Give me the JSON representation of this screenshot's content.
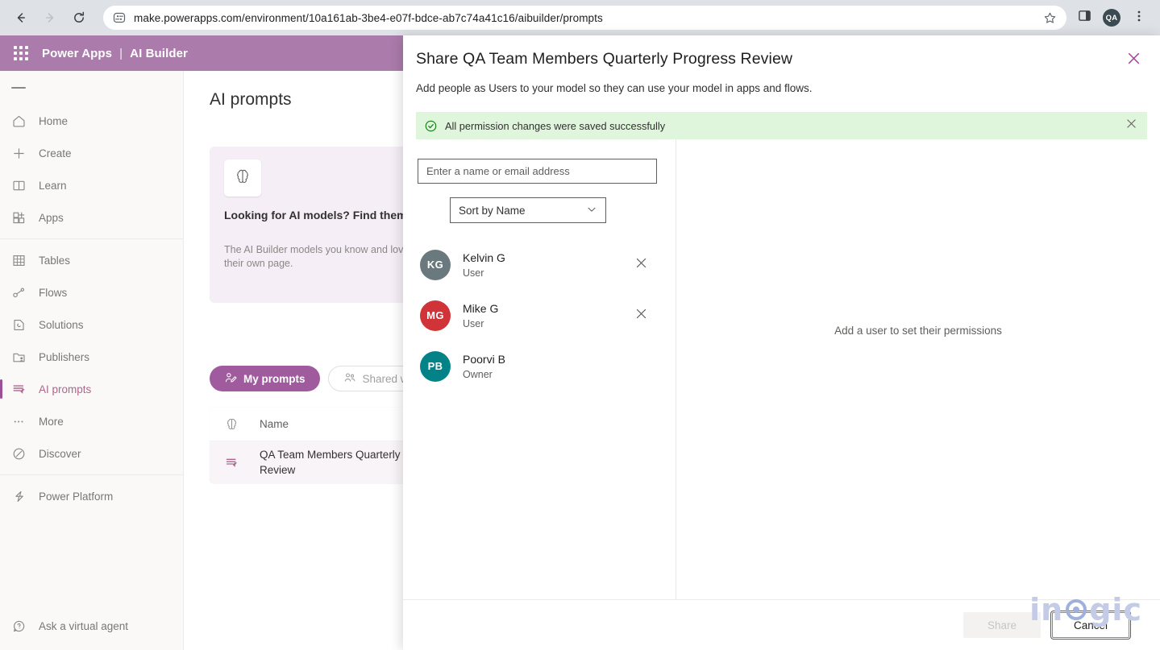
{
  "browser": {
    "back_icon": "back-arrow-icon",
    "forward_icon": "forward-arrow-icon",
    "reload_icon": "reload-icon",
    "site_settings_icon": "site-settings-icon",
    "url": "make.powerapps.com/environment/10a161ab-3be4-e07f-bdce-ab7c74a41c16/aibuilder/prompts",
    "bookmark_icon": "star-icon",
    "sidepanel_icon": "side-panel-icon",
    "profile_initials": "QA",
    "menu_icon": "three-dot-menu-icon"
  },
  "app_header": {
    "waffle_icon": "app-launcher-icon",
    "product": "Power Apps",
    "separator": "|",
    "section": "AI Builder"
  },
  "sidebar": {
    "menu_icon": "hamburger-menu-icon",
    "items": [
      {
        "label": "Home",
        "icon": "home-icon",
        "selected": false
      },
      {
        "label": "Create",
        "icon": "plus-icon",
        "selected": false
      },
      {
        "label": "Learn",
        "icon": "book-icon",
        "selected": false
      },
      {
        "label": "Apps",
        "icon": "apps-grid-icon",
        "selected": false
      },
      {
        "label": "Tables",
        "icon": "table-grid-icon",
        "selected": false
      },
      {
        "label": "Flows",
        "icon": "flow-icon",
        "selected": false
      },
      {
        "label": "Solutions",
        "icon": "solutions-icon",
        "selected": false
      },
      {
        "label": "Publishers",
        "icon": "publishers-icon",
        "selected": false
      },
      {
        "label": "AI prompts",
        "icon": "ai-prompts-icon",
        "selected": true
      },
      {
        "label": "More",
        "icon": "ellipsis-icon",
        "selected": false
      },
      {
        "label": "Discover",
        "icon": "discover-icon",
        "selected": false
      },
      {
        "label": "Power Platform",
        "icon": "power-platform-icon",
        "selected": false
      }
    ],
    "footer": {
      "label": "Ask a virtual agent",
      "icon": "question-chat-icon"
    }
  },
  "main": {
    "page_title": "AI prompts",
    "promo": {
      "icon": "ai-brain-icon",
      "close_icon": "close-icon",
      "heading": "Looking for AI models? Find them here.",
      "body": "The AI Builder models you know and love have their own page."
    },
    "tabs": [
      {
        "label": "My prompts",
        "icon": "person-edit-icon",
        "active": true
      },
      {
        "label": "Shared with",
        "icon": "people-icon",
        "active": false
      }
    ],
    "list": {
      "header_icon": "brain-outline-icon",
      "header_name": "Name",
      "rows": [
        {
          "icon": "ai-prompt-icon",
          "name": "QA Team Members Quarterly Review"
        }
      ]
    }
  },
  "panel": {
    "title": "Share QA Team Members Quarterly Progress Review",
    "subtitle": "Add people as Users to your model so they can use your model in apps and flows.",
    "close_icon": "close-icon",
    "banner": {
      "icon": "success-check-icon",
      "text": "All permission changes were saved successfully",
      "close_icon": "close-icon",
      "background": "#dff6dd",
      "accent": "#107c10"
    },
    "search": {
      "value": "",
      "placeholder": "Enter a name or email address"
    },
    "sort": {
      "selected": "Sort by Name",
      "chevron_icon": "chevron-down-icon",
      "options": [
        "Sort by Name"
      ]
    },
    "users": [
      {
        "initials": "KG",
        "name": "Kelvin G",
        "role": "User",
        "color": "#69797e",
        "removable": true
      },
      {
        "initials": "MG",
        "name": "Mike G",
        "role": "User",
        "color": "#d13438",
        "removable": true
      },
      {
        "initials": "PB",
        "name": "Poorvi B",
        "role": "Owner",
        "color": "#038387",
        "removable": false
      }
    ],
    "remove_icon": "close-icon",
    "right_hint": "Add a user to set their permissions",
    "footer": {
      "share_label": "Share",
      "share_disabled": true,
      "cancel_label": "Cancel",
      "cancel_focused": true
    }
  },
  "watermark": {
    "text_before": "in",
    "text_after": "gic",
    "color": "#c3cbe6"
  },
  "theme": {
    "brand_purple": "#ab7bab",
    "accent_purple": "#a05a9e",
    "success_green": "#107c10",
    "chrome_gray": "#dee1e6"
  }
}
